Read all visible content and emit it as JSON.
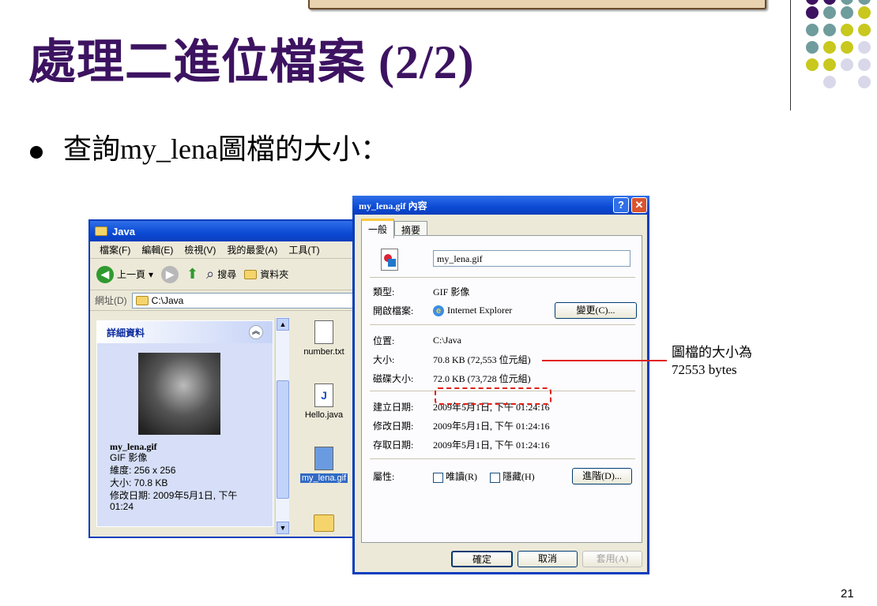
{
  "slide": {
    "title": "處理二進位檔案 (2/2)",
    "bullet": "查詢my_lena圖檔的大小：",
    "page_number": "21",
    "callout": {
      "line1": "圖檔的大小為",
      "line2": "72553 bytes"
    },
    "accent_colors": {
      "title": "#3d1361",
      "dot_purple": "#3d1361",
      "dot_teal": "#6f9c9c",
      "dot_yellow": "#c8c81e",
      "dot_lavender": "#d8d8ea",
      "highlight": "#e2201a"
    }
  },
  "explorer": {
    "title": "Java",
    "menu": [
      "檔案(F)",
      "編輯(E)",
      "檢視(V)",
      "我的最愛(A)",
      "工具(T)"
    ],
    "toolbar": {
      "back": "上一頁",
      "search": "搜尋",
      "folders": "資料夾"
    },
    "address_label": "網址(D)",
    "address_value": "C:\\Java",
    "details": {
      "header": "詳細資料",
      "filename": "my_lena.gif",
      "type": "GIF 影像",
      "dimensions": "維度: 256 x 256",
      "size": "大小: 70.8 KB",
      "modified": "修改日期: 2009年5月1日, 下午 01:24"
    },
    "files": [
      "number.txt",
      "Hello.java",
      "my_lena.gif"
    ]
  },
  "dialog": {
    "title": "my_lena.gif 內容",
    "tabs": [
      "一般",
      "摘要"
    ],
    "filename": "my_lena.gif",
    "type_label": "類型:",
    "type_value": "GIF 影像",
    "opens_label": "開啟檔案:",
    "opens_value": "Internet Explorer",
    "change_button": "變更(C)...",
    "location_label": "位置:",
    "location_value": "C:\\Java",
    "size_label": "大小:",
    "size_value": "70.8 KB (72,553 位元組)",
    "disk_label": "磁碟大小:",
    "disk_value": "72.0 KB (73,728 位元組)",
    "created_label": "建立日期:",
    "created_value": "2009年5月1日, 下午 01:24:16",
    "modified_label": "修改日期:",
    "modified_value": "2009年5月1日, 下午 01:24:16",
    "accessed_label": "存取日期:",
    "accessed_value": "2009年5月1日, 下午 01:24:16",
    "attr_label": "屬性:",
    "readonly": "唯讀(R)",
    "hidden": "隱藏(H)",
    "advanced_button": "進階(D)...",
    "ok": "確定",
    "cancel": "取消",
    "apply": "套用(A)"
  }
}
